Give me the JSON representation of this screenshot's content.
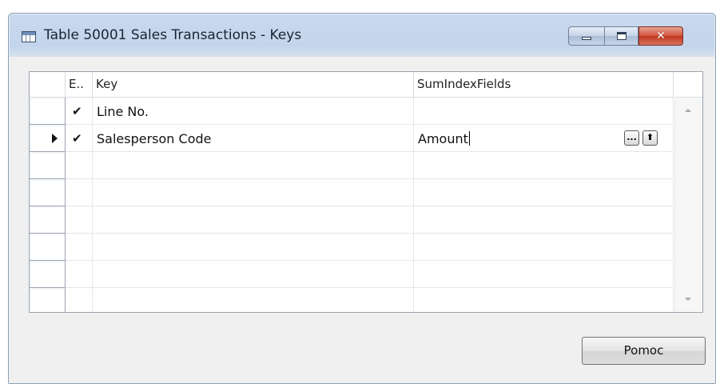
{
  "window": {
    "title": "Table 50001 Sales Transactions - Keys",
    "close_glyph": "✕"
  },
  "grid": {
    "columns": [
      "E..",
      "Key",
      "SumIndexFields"
    ],
    "rows": [
      {
        "enabled": "✔",
        "key": "Line No.",
        "sum_index_fields": "",
        "current": false
      },
      {
        "enabled": "✔",
        "key": "Salesperson Code",
        "sum_index_fields": "Amount",
        "current": true
      }
    ],
    "empty_row_count": 6,
    "lookup_button": "...",
    "assist_button": "⬆"
  },
  "buttons": {
    "help": "Pomoc"
  },
  "icons": {
    "title": "table-icon",
    "current_row": "row-pointer-icon",
    "check": "checkmark-icon"
  }
}
